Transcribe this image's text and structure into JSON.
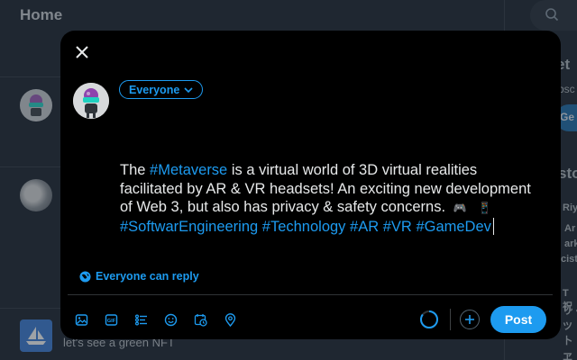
{
  "background": {
    "header_title": "Home",
    "post_text": "let's see a green NFT",
    "right_fragments": [
      "et",
      "bsc",
      "Ge",
      "sto",
      "Riy",
      "Ar",
      "ark",
      "cist",
      "T祝",
      "リ・",
      "ツ卜",
      "ヱイ"
    ]
  },
  "composer": {
    "audience_label": "Everyone",
    "tweet": {
      "t1": "The ",
      "tag_metaverse": "#Metaverse",
      "t2": " is a virtual world of 3D virtual realities facilitated by AR & VR headsets! An exciting new development of Web 3, but also has privacy & safety concerns.",
      "emoji1": "🎮",
      "emoji2": "📱",
      "tag_software": "#SoftwarEngineering",
      "tag_technology": "#Technology",
      "tag_ar": "#AR",
      "tag_vr": "#VR",
      "tag_gamedev": "#GameDev"
    },
    "reply_setting": "Everyone can reply",
    "post_button": "Post"
  },
  "toolbar_icons": [
    "media-icon",
    "gif-icon",
    "poll-icon",
    "emoji-icon",
    "schedule-icon",
    "location-icon"
  ],
  "colors": {
    "accent": "#1d9bf0",
    "modal_bg": "#000000",
    "page_bg": "#18202a"
  }
}
